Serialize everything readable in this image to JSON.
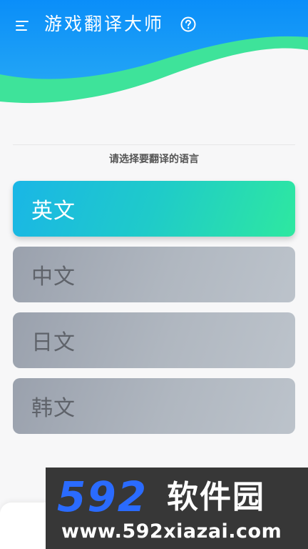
{
  "header": {
    "title": "游戏翻译大师",
    "colors": {
      "top": "#0a8ef9",
      "bottom": "#22a4f5",
      "wave_band": "#3ee39a"
    }
  },
  "icons": {
    "menu": "menu-icon",
    "help": "help-circle-icon"
  },
  "content": {
    "prompt": "请选择要翻译的语言",
    "languages": [
      {
        "label": "英文",
        "selected": true
      },
      {
        "label": "中文",
        "selected": false
      },
      {
        "label": "日文",
        "selected": false
      },
      {
        "label": "韩文",
        "selected": false
      }
    ],
    "colors": {
      "selected_gradient_start": "#1ab6e6",
      "selected_gradient_end": "#2ee8a0",
      "unselected_gradient_start": "#9aa1ad",
      "unselected_gradient_end": "#bcc3cb"
    }
  },
  "watermark": {
    "brand_number": "592",
    "brand_text": "软件园",
    "url": "www.592xiazai.com"
  }
}
